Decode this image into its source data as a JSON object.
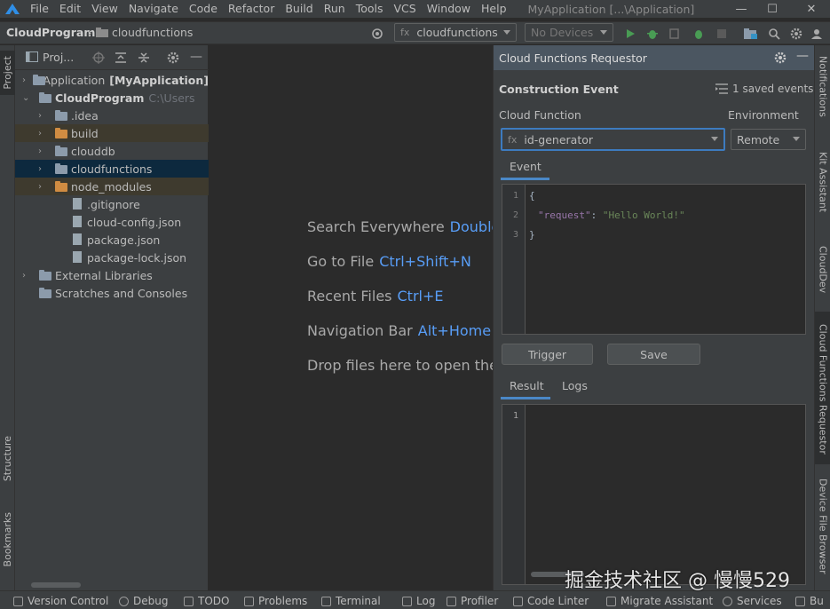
{
  "menubar": {
    "items": [
      "File",
      "Edit",
      "View",
      "Navigate",
      "Code",
      "Refactor",
      "Build",
      "Run",
      "Tools",
      "VCS",
      "Window",
      "Help"
    ],
    "window_title": "MyApplication [...\\Application]"
  },
  "navbar": {
    "project": "CloudProgram",
    "folder": "cloudfunctions",
    "run_config": "cloudfunctions",
    "device": "No Devices"
  },
  "left_tabs": {
    "project": "Project",
    "structure": "Structure",
    "bookmarks": "Bookmarks"
  },
  "project_panel": {
    "title": "Proj...",
    "tree": [
      {
        "label": "Application",
        "suffix": "[MyApplication]",
        "level": 0,
        "chevron": "›",
        "icon": "module"
      },
      {
        "label": "CloudProgram",
        "suffix": "C:\\Users",
        "level": 0,
        "chevron": "⌄",
        "icon": "module"
      },
      {
        "label": ".idea",
        "level": 1,
        "chevron": "›",
        "icon": "folder-gray"
      },
      {
        "label": "build",
        "level": 1,
        "chevron": "›",
        "icon": "folder-orange"
      },
      {
        "label": "clouddb",
        "level": 1,
        "chevron": "›",
        "icon": "folder-gray"
      },
      {
        "label": "cloudfunctions",
        "level": 1,
        "chevron": "›",
        "icon": "folder-gray"
      },
      {
        "label": "node_modules",
        "level": 1,
        "chevron": "›",
        "icon": "folder-orange"
      },
      {
        "label": ".gitignore",
        "level": 2,
        "chevron": "",
        "icon": "file"
      },
      {
        "label": "cloud-config.json",
        "level": 2,
        "chevron": "",
        "icon": "file"
      },
      {
        "label": "package.json",
        "level": 2,
        "chevron": "",
        "icon": "file"
      },
      {
        "label": "package-lock.json",
        "level": 2,
        "chevron": "",
        "icon": "file"
      },
      {
        "label": "External Libraries",
        "level": 0,
        "chevron": "›",
        "icon": "library"
      },
      {
        "label": "Scratches and Consoles",
        "level": 0,
        "chevron": "",
        "icon": "scratches"
      }
    ]
  },
  "editor_hints": [
    {
      "text": "Search Everywhere",
      "key": "Double"
    },
    {
      "text": "Go to File",
      "key": "Ctrl+Shift+N"
    },
    {
      "text": "Recent Files",
      "key": "Ctrl+E"
    },
    {
      "text": "Navigation Bar",
      "key": "Alt+Home"
    },
    {
      "text": "Drop files here to open the",
      "key": ""
    }
  ],
  "requestor": {
    "title": "Cloud Functions Requestor",
    "construction_event": "Construction Event",
    "saved_events": "1 saved events",
    "cloud_function_label": "Cloud Function",
    "environment_label": "Environment",
    "function_value": "id-generator",
    "environment_value": "Remote",
    "event_tab": "Event",
    "code_lines": [
      {
        "n": "1",
        "text": "{"
      },
      {
        "n": "2",
        "key": "\"request\"",
        "sep": ": ",
        "value": "\"Hello World!\""
      },
      {
        "n": "3",
        "text": "}"
      }
    ],
    "trigger_button": "Trigger",
    "save_button": "Save",
    "result_tab": "Result",
    "logs_tab": "Logs",
    "result_line": "1"
  },
  "right_tabs": {
    "notifications": "Notifications",
    "kit_assistant": "Kit Assistant",
    "clouddev": "CloudDev",
    "cloud_functions_requestor": "Cloud Functions Requestor",
    "device_file_browser": "Device File Browser"
  },
  "statusbar": {
    "items": [
      "Version Control",
      "Debug",
      "TODO",
      "Problems",
      "Terminal",
      "Log",
      "Profiler",
      "Code Linter",
      "Migrate Assistant",
      "Services",
      "Bu"
    ]
  },
  "watermark": "掘金技术社区 @ 慢慢529",
  "colors": {
    "accent_blue": "#589df6",
    "selection": "#0d293e",
    "excluded_folder_bg": "#3e3a2e",
    "run_green": "#499c54",
    "string_green": "#6a8759",
    "json_key": "#9876aa"
  }
}
